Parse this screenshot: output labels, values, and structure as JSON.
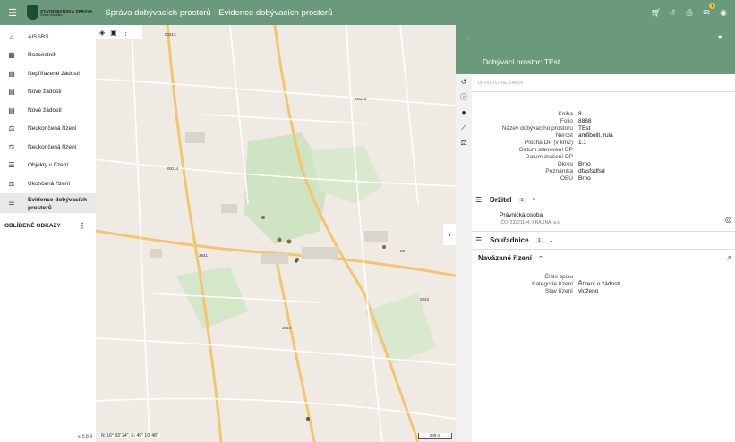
{
  "header": {
    "logo_line1": "STÁTNÍ BÁŇSKÁ SPRÁVA",
    "logo_line2": "České republiky",
    "title": "Správa dobývacích prostorů - Evidence dobývacích prostorů",
    "notification_count": "1"
  },
  "sidebar": {
    "items": [
      {
        "label": "AISSBS",
        "icon": "home-icon",
        "glyph": "⌂"
      },
      {
        "label": "Rozcestník",
        "icon": "dashboard-icon",
        "glyph": "▦"
      },
      {
        "label": "Nepřiřazené žádosti",
        "icon": "document-icon",
        "glyph": "▤"
      },
      {
        "label": "Nové žádosti",
        "icon": "document-icon",
        "glyph": "▤"
      },
      {
        "label": "Nové žádosti",
        "icon": "document-icon",
        "glyph": "▤"
      },
      {
        "label": "Neukončená řízení",
        "icon": "gavel-icon",
        "glyph": "⚖"
      },
      {
        "label": "Neukončená řízení",
        "icon": "gavel-icon",
        "glyph": "⚖"
      },
      {
        "label": "Objekty v řízení",
        "icon": "list-icon",
        "glyph": "☰"
      },
      {
        "label": "Ukončená řízení",
        "icon": "gavel-icon",
        "glyph": "⚖"
      }
    ],
    "active_line1": "Evidence dobývacích",
    "active_line2": "prostorů",
    "favorites": "OBLÍBENÉ ODKAZY",
    "version": "v. 5.8.4"
  },
  "map": {
    "coords": "N: 16° 33' 24\", E: 49° 10' 48\"",
    "scale": "200 m",
    "road_labels": [
      "00213",
      "00215",
      "00214",
      "23",
      "3841",
      "3942",
      "3944"
    ]
  },
  "panel": {
    "title": "Dobývací prostor: TEst",
    "history_label": "HISTORIE ZMĚN",
    "details": [
      {
        "k": "Kniha",
        "v": "8"
      },
      {
        "k": "Folio",
        "v": "8888"
      },
      {
        "k": "Název dobývacího prostoru",
        "v": "TEst"
      },
      {
        "k": "Nerost",
        "v": "amfibolit, rula"
      },
      {
        "k": "Plocha DP (v km2)",
        "v": "1.1"
      },
      {
        "k": "Datum stanovení DP",
        "v": ""
      },
      {
        "k": "Datum zrušení DP",
        "v": ""
      },
      {
        "k": "Okres",
        "v": "Brno"
      },
      {
        "k": "Poznámka",
        "v": "dfasfsdfsd"
      },
      {
        "k": "OBÚ",
        "v": "Brno"
      }
    ],
    "holder_title": "Držitel",
    "holder_count": "1",
    "holder_name": "Právnická osoba",
    "holder_detail": "IČO: 33221144, KRAJINA, a.s.",
    "coords_title": "Souřadnice",
    "coords_count": "1",
    "linked_title": "Navázané řízení",
    "linked": [
      {
        "k": "Číslo spisu",
        "v": ""
      },
      {
        "k": "Kategorie řízení",
        "v": "Řízení o žádosti"
      },
      {
        "k": "Stav řízení",
        "v": "vloženo"
      }
    ]
  }
}
